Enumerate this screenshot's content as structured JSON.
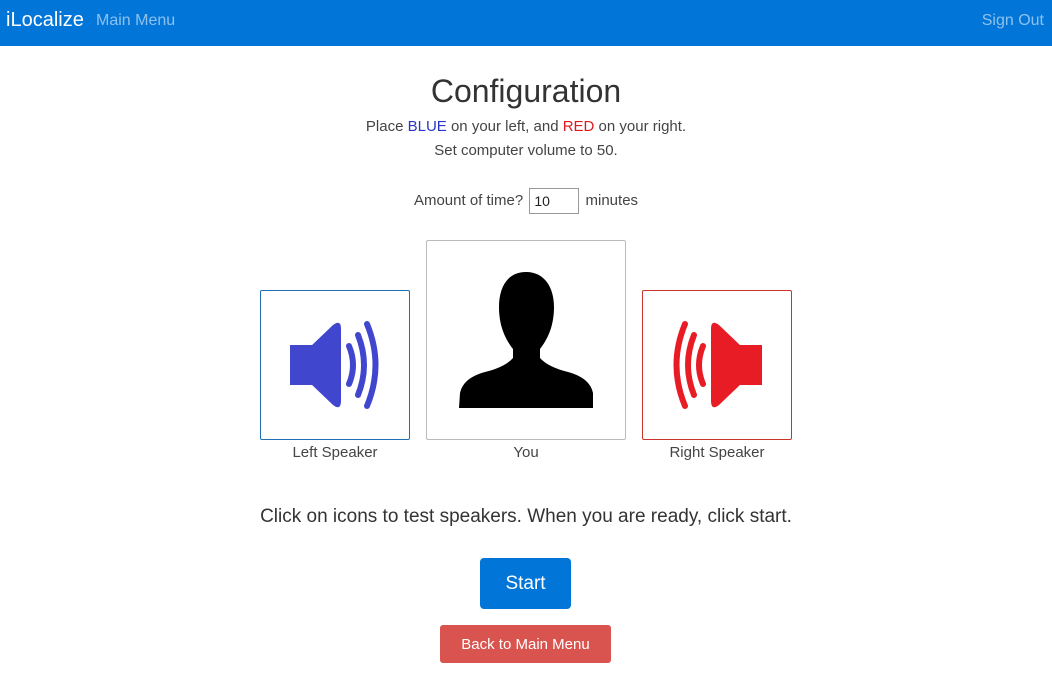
{
  "navbar": {
    "brand": "iLocalize",
    "main_menu": "Main Menu",
    "sign_out": "Sign Out"
  },
  "config": {
    "title": "Configuration",
    "place_prefix": "Place ",
    "blue_word": "BLUE",
    "place_middle": " on your left, and ",
    "red_word": "RED",
    "place_suffix": " on your right.",
    "volume_text": "Set computer volume to 50.",
    "time_label": "Amount of time?",
    "time_value": "10",
    "time_unit": "minutes"
  },
  "positions": {
    "left_label": "Left Speaker",
    "you_label": "You",
    "right_label": "Right Speaker",
    "left_icon": "speaker-left-icon",
    "you_icon": "person-silhouette-icon",
    "right_icon": "speaker-right-icon"
  },
  "instructions": "Click on icons to test speakers. When you are ready, click start.",
  "buttons": {
    "start": "Start",
    "back": "Back to Main Menu"
  },
  "colors": {
    "navbar": "#0275d8",
    "blue_speaker": "#4146cf",
    "red_speaker": "#e81c25",
    "back_button": "#d9534f"
  }
}
